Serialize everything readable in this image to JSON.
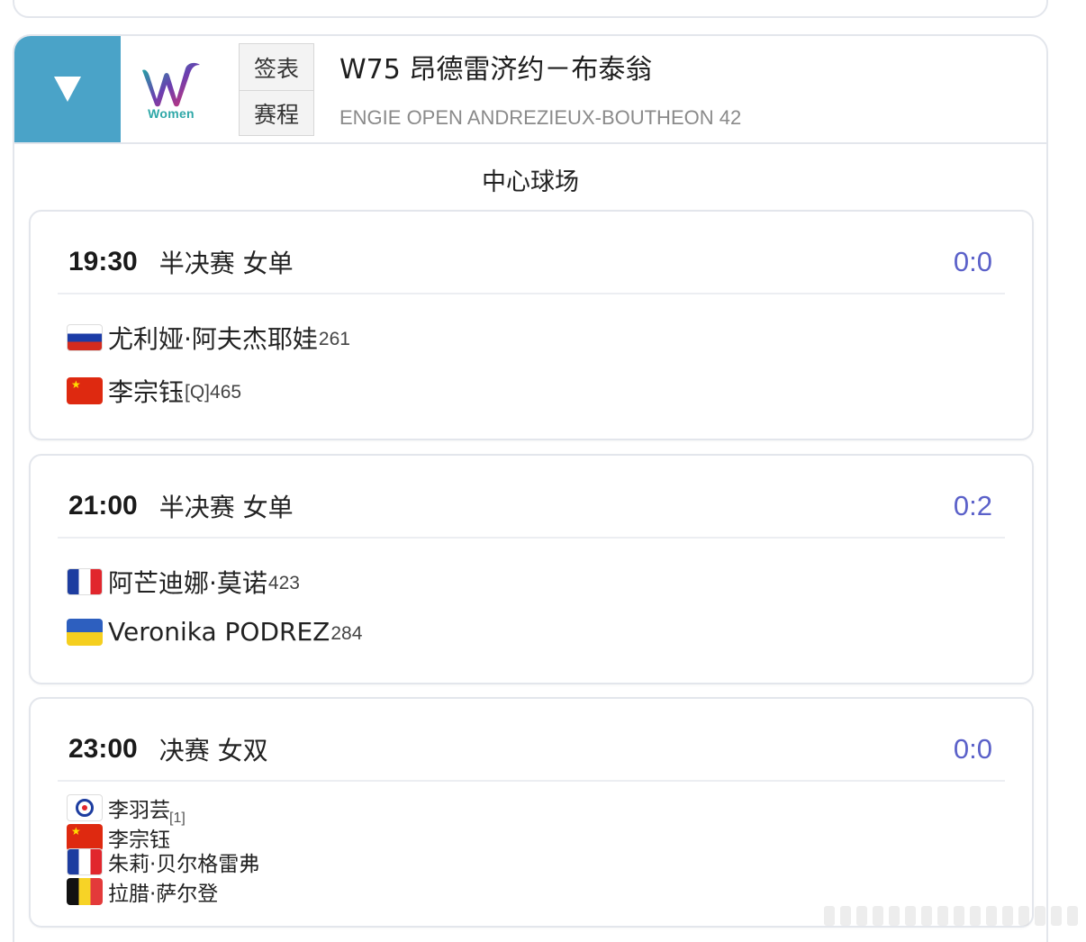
{
  "tournament": {
    "title": "W75 昂德雷济约－布泰翁",
    "subtitle": "ENGIE OPEN ANDREZIEUX-BOUTHEON 42",
    "logo_text": "Women",
    "tabs": [
      {
        "label": "签表"
      },
      {
        "label": "赛程"
      }
    ],
    "court": "中心球场",
    "accent_color": "#4aa3c8",
    "score_color": "#5b61c9"
  },
  "matches": [
    {
      "time": "19:30",
      "desc": "半决赛 女单",
      "score": "0:0",
      "players": [
        {
          "flag": "russia-flag",
          "name": "尤利娅·阿夫杰耶娃",
          "rank": "261"
        },
        {
          "flag": "china-flag",
          "name": "李宗钰",
          "rank": "[Q]465"
        }
      ]
    },
    {
      "time": "21:00",
      "desc": "半决赛 女单",
      "score": "0:2",
      "players": [
        {
          "flag": "france-flag",
          "name": "阿芒迪娜·莫诺",
          "rank": "423"
        },
        {
          "flag": "ukraine-flag",
          "name": "Veronika PODREZ",
          "rank": "284"
        }
      ]
    },
    {
      "time": "23:00",
      "desc": "决赛 女双",
      "score": "0:0",
      "team1_seed": "[1]",
      "players": [
        {
          "flag": "chinese-taipei-flag",
          "name": "李羽芸"
        },
        {
          "flag": "china-flag",
          "name": "李宗钰"
        },
        {
          "flag": "france-flag",
          "name": "朱莉·贝尔格雷弗"
        },
        {
          "flag": "belgium-flag",
          "name": "拉腊·萨尔登"
        }
      ]
    }
  ]
}
